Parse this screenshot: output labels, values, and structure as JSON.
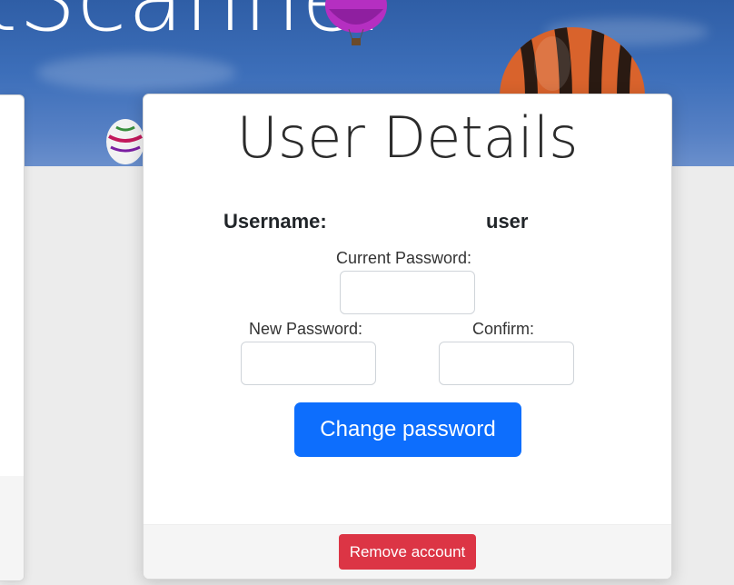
{
  "hero": {
    "title_fragment": "tScanner"
  },
  "card": {
    "title": "User Details",
    "username_label": "Username:",
    "username_value": "user",
    "current_password_label": "Current Password:",
    "current_password_value": "",
    "new_password_label": "New Password:",
    "new_password_value": "",
    "confirm_label": "Confirm:",
    "confirm_value": "",
    "change_password_button": "Change password",
    "remove_account_button": "Remove account"
  },
  "colors": {
    "primary": "#0d6efd",
    "danger": "#dc3545",
    "sky": "#3d6fba"
  }
}
